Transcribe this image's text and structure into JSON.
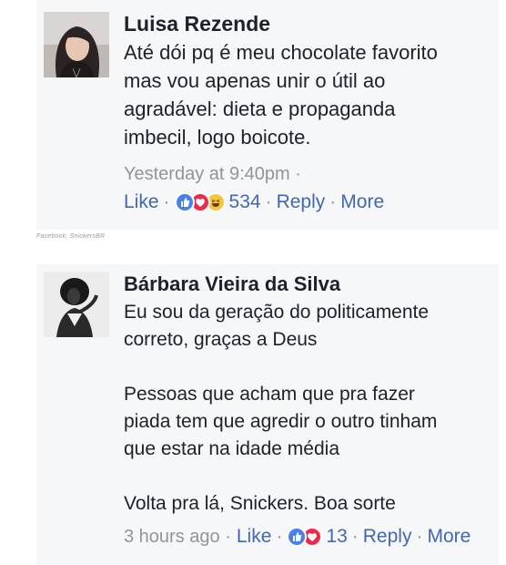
{
  "comments": [
    {
      "author": "Luisa Rezende",
      "text_lines": [
        "Até dói pq é meu chocolate favorito",
        "mas vou apenas unir o útil ao",
        "agradável: dieta e propaganda",
        "imbecil, logo boicote."
      ],
      "timestamp": "Yesterday at 9:40pm ·",
      "actions": {
        "like": "Like",
        "reaction_icons": [
          "like-icon",
          "love-icon",
          "haha-icon"
        ],
        "reaction_count": "534",
        "reply": "Reply",
        "more": "More"
      }
    },
    {
      "author": "Bárbara Vieira da Silva",
      "paragraphs": [
        [
          "Eu sou da geração do politicamente",
          "correto, graças a Deus"
        ],
        [
          "Pessoas que acham que pra fazer",
          "piada tem que agredir o outro tinham",
          "que estar na idade média"
        ],
        [
          "Volta pra lá, Snickers. Boa sorte"
        ]
      ],
      "timestamp": "3 hours ago ·",
      "actions": {
        "like": "Like",
        "reaction_icons": [
          "like-icon",
          "love-icon"
        ],
        "reaction_count": "13",
        "reply": "Reply",
        "more": "More"
      }
    }
  ],
  "caption": "Facebook: SnickersBR",
  "colors": {
    "card_bg": "#f6f7f9",
    "text": "#1d2129",
    "meta": "#90949c",
    "link": "#4267b2",
    "like_reaction": "#4a7ff0",
    "love_reaction": "#f0284a",
    "haha_reaction": "#f7c53b"
  }
}
